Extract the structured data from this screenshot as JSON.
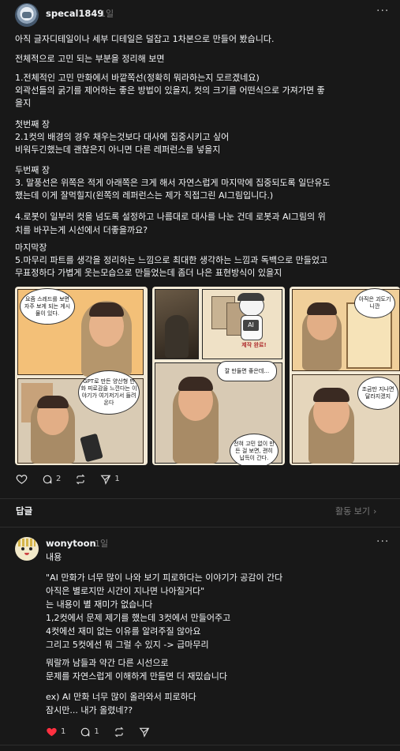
{
  "post": {
    "username": "specal1849",
    "time": "1일",
    "paragraphs": [
      "아직 글자디테일이나 세부 디테일은 덜잡고 1차본으로 만들어 봤습니다.",
      "전체적으로 고민 되는 부분을 정리해 보면",
      "1.전체적인 고민 만화에서 바깥쪽선(정확히 뭐라하는지 모르겠네요)\n외곽선들의 굵기를 제어하는 좋은 방법이 있을지, 컷의 크기를 어떤식으로 가져가면 좋\n을지",
      "첫번째 장\n2.1컷의 배경의 경우 채우는것보다 대사에 집중시키고 싶어\n비워두긴했는데 괜찮은지 아니면 다른 레퍼런스를 넣을지",
      "두번째 장\n3. 말풍선은 위쪽은 적게 아래쪽은 크게 해서 자연스럽게 마지막에 집중되도록 일단유도\n했는데 이게 잘먹힐지(왼쪽의 레퍼런스는 제가 직접그린 AI그림입니다.)",
      "4.로봇이 일부러 컷을 넘도록 설정하고 나름대로 대사를 나눈 건데 로봇과 AI그림의 위\n치를 바꾸는게 시선에서 더좋을까요?",
      "마지막장\n5.마무리 파트를 생각을 정리하는 느낌으로 최대한 생각하는 느낌과 독백으로 만들었고\n무표정하다 가볍게 웃는모습으로 만들었는데 좀더 나은 표현방식이 있을지"
    ],
    "comic": {
      "p1_bubble_top": "요즘 스레드를 보면 자주 보게 되는 게시물이 있다.",
      "p1_bubble_bottom": "GPT로 만든 양산형 만화 피로감을 느낀다는 이야기가 여기저기서 들려온다",
      "p2_robot_badge": "AI",
      "p2_robot_text": "제작 완료!",
      "p2_bubble_top": "잘 만들면 좋은데…",
      "p2_bubble_bottom": "전혀 고민 없이 만든 걸 보면, 괜히 납득이 간다.",
      "p3_bubble_top": "아직은 괴도기니깐",
      "p3_bubble_bottom": "조금만 지나면 달라지겠지"
    },
    "likes": "",
    "comments": "2",
    "reposts": "",
    "shares": "1"
  },
  "replies_header": {
    "label": "답글",
    "activity": "활동 보기"
  },
  "reply": {
    "username": "wonytoon",
    "time": "1일",
    "intro": "내용",
    "quote": "\"AI 만화가 너무 많이 나와 보기 피로하다는 이야기가 공감이 간다\n아직은 별로지만 시간이 지나면 나아질거다\"\n는 내용이 별 재미가 없습니다\n1,2컷에서 문제 제기를 했는데 3컷에서 만들어주고\n4컷에선 재미 없는 이유를 알려주질 않아요\n그리고 5컷에선 뭐 그럴 수 있지 -> 급마무리",
    "para2": "뭐랄까 남들과 약간 다른 시선으로\n문제를 자연스럽게 이해하게 만들면 더 재밌습니다",
    "para3": "ex) AI 만화 너무 많이 올라와서 피로하다\n잠시만... 내가 올렸네??",
    "likes": "1",
    "comments": "1"
  },
  "colors": {
    "background": "#181818",
    "text": "#f3f5f7",
    "muted": "#7a7a7a",
    "like_red": "#ff3040"
  }
}
